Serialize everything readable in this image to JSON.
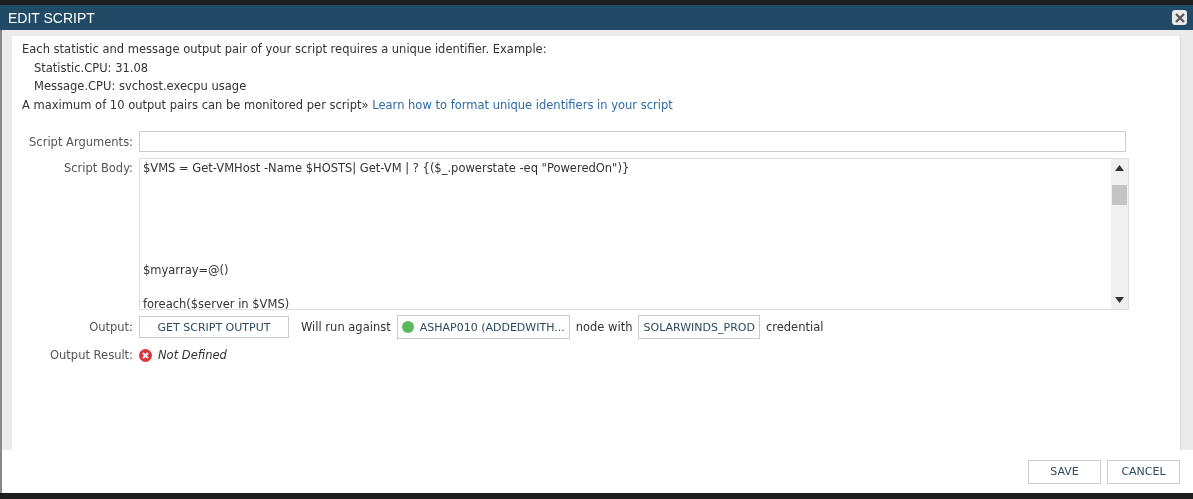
{
  "dialog": {
    "title": "EDIT SCRIPT"
  },
  "help": {
    "intro": "Each statistic and message output pair of your script requires a unique identifier. Example:",
    "examples": [
      "Statistic.CPU: 31.08",
      "Message.CPU: svchost.execpu usage"
    ],
    "limit": "A maximum of 10 output pairs can be monitored per script»",
    "link": "Learn how to format unique identifiers in your script"
  },
  "script_arguments": {
    "label": "Script Arguments:"
  },
  "script_body": {
    "label": "Script Body:",
    "value": "$VMS = Get-VMHost -Name $HOSTS| Get-VM | ? {($_.powerstate -eq \"PoweredOn\")}\n\n\n\n\n\n$myarray=@()\n\nforeach($server in $VMS)"
  },
  "output": {
    "label": "Output:",
    "button": "GET SCRIPT OUTPUT",
    "run_against": "Will run against",
    "node": {
      "name": "ASHAP010 (ADDEDWITH...",
      "online": true
    },
    "node_with": "node with",
    "credential": "SOLARWINDS_PROD",
    "credential_suffix": "credential"
  },
  "output_result": {
    "label": "Output Result:",
    "error": true,
    "value": "Not Defined"
  },
  "buttons": [
    "SAVE",
    "CANCEL"
  ]
}
